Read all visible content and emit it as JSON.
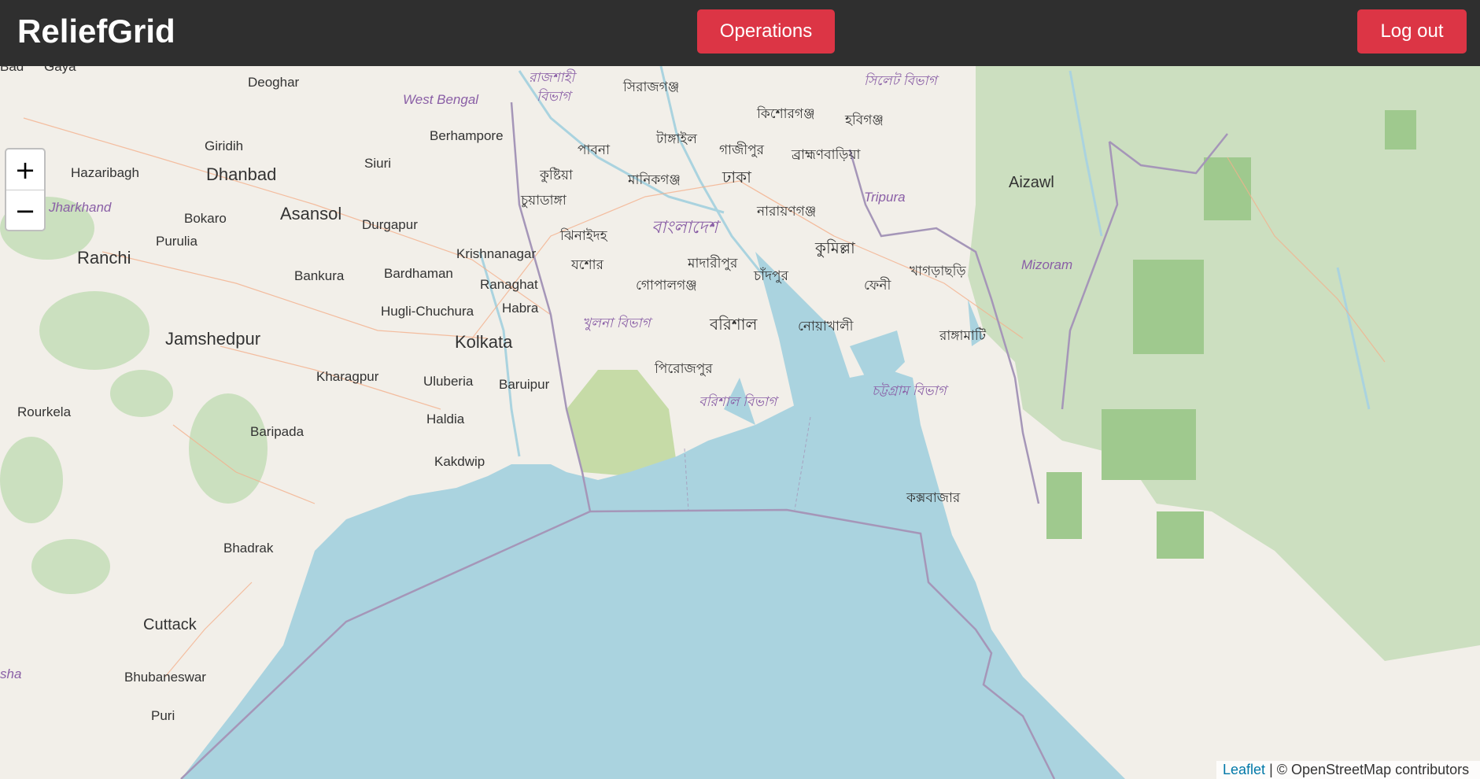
{
  "header": {
    "brand": "ReliefGrid",
    "operations_label": "Operations",
    "logout_label": "Log out"
  },
  "colors": {
    "header_bg": "#2f2f2f",
    "button_bg": "#dc3545",
    "water": "#aad3df",
    "land": "#f2efe9",
    "forest": "#add19e",
    "border": "#a596b8"
  },
  "map": {
    "zoom_in": "+",
    "zoom_out": "−",
    "attribution_link": "Leaflet",
    "attribution_text": "| © OpenStreetMap contributors",
    "labels": [
      "Deoghar",
      "West Bengal",
      "রাজশাহী",
      "বিভাগ",
      "সিরাজগঞ্জ",
      "সিলেট বিভাগ",
      "কিশোরগঞ্জ",
      "হবিগঞ্জ",
      "Berhampore",
      "Giridih",
      "Siuri",
      "পাবনা",
      "টাঙ্গাইল",
      "গাজীপুর",
      "ব্রাহ্মণবাড়িয়া",
      "Hazaribagh",
      "Dhanbad",
      "কুষ্টিয়া",
      "মানিকগঞ্জ",
      "ঢাকা",
      "Aizawl",
      "Jharkhand",
      "চুয়াডাঙ্গা",
      "Tripura",
      "Bokaro",
      "Asansol",
      "Durgapur",
      "ঝিনাইদহ",
      "বাংলাদেশ",
      "নারায়ণগঞ্জ",
      "Purulia",
      "Krishnanagar",
      "যশোর",
      "মাদারীপুর",
      "কুমিল্লা",
      "Mizoram",
      "Ranchi",
      "Bankura",
      "Bardhaman",
      "Ranaghat",
      "গোপালগঞ্জ",
      "চাঁদপুর",
      "ফেনী",
      "খাগড়াছড়ি",
      "Hugli-Chuchura",
      "Habra",
      "খুলনা বিভাগ",
      "বরিশাল",
      "নোয়াখালী",
      "রাঙ্গামাটি",
      "Jamshedpur",
      "Kolkata",
      "পিরোজপুর",
      "Kharagpur",
      "Uluberia",
      "Baruipur",
      "চট্টগ্রাম বিভাগ",
      "বরিশাল বিভাগ",
      "Rourkela",
      "Haldia",
      "Baripada",
      "Kakdwip",
      "কক্সবাজার",
      "Bhadrak",
      "Cuttack",
      "Bhubaneswar",
      "Puri",
      "sha",
      "Gaya",
      "Bad"
    ]
  }
}
